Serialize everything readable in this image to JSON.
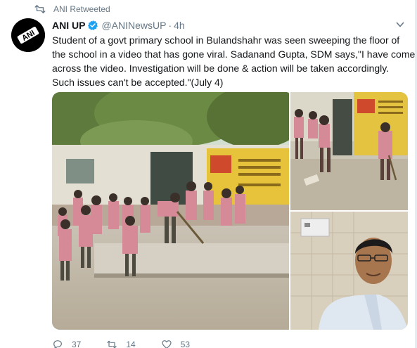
{
  "retweet": {
    "label": "ANI Retweeted",
    "icon": "retweet-icon"
  },
  "tweet": {
    "author": {
      "display_name": "ANI UP",
      "handle": "@ANINewsUP",
      "verified": true,
      "avatar_text": "ANI"
    },
    "separator": "·",
    "timestamp": "4h",
    "text_lines": [
      "Student of a govt primary school in Bulandshahr was seen sweeping the floor of",
      "the school in a video that has gone viral. Sadanand Gupta, SDM says,\"I have come",
      "across the video. Investigation will be done & action will be taken accordingly.",
      "Such issues can't be accepted.\"(July 4)"
    ],
    "media": [
      {
        "name": "school-courtyard-photo"
      },
      {
        "name": "student-sweeping-photo"
      },
      {
        "name": "sdm-portrait-photo"
      }
    ],
    "actions": {
      "reply": {
        "icon": "reply-icon",
        "count": "37"
      },
      "retweet": {
        "icon": "retweet-icon",
        "count": "14"
      },
      "like": {
        "icon": "heart-icon",
        "count": "53"
      }
    }
  },
  "colors": {
    "text_primary": "#14171a",
    "text_secondary": "#657786",
    "verified_blue": "#1da1f2"
  }
}
